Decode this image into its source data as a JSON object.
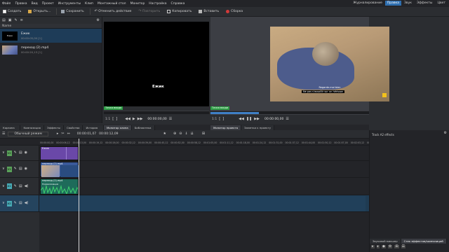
{
  "menu": [
    "Файл",
    "Правка",
    "Вид",
    "Проект",
    "Инструменты",
    "Клип",
    "Монтажный стол",
    "Монитор",
    "Настройка",
    "Справка"
  ],
  "workspaces": {
    "items": [
      "Журналирование",
      "Правка",
      "Звук",
      "Эффекты",
      "Цвет"
    ],
    "active": "Правка"
  },
  "toolbar": {
    "create": "Создать",
    "open": "Открыть...",
    "save": "Сохранить",
    "undo": "Отменить действие",
    "redo": "Повторить",
    "copy": "Копировать",
    "paste": "Вставить",
    "render": "Сборка"
  },
  "bin": {
    "column": "Name",
    "items": [
      {
        "name": "Ежик",
        "sub": "00:00:05,00 [1]"
      },
      {
        "name": "переход (2).mp4",
        "sub": "00:00:20,13 [1]"
      }
    ]
  },
  "clip_monitor": {
    "title_text": "Ежик",
    "zone": "Точка входа",
    "zoom": "1:1",
    "timecode": "00:00:00,00"
  },
  "project_monitor": {
    "subtitle1": "Regarde-moi bien",
    "subtitle2": "Ne pas s'assaillir sur un hérisson",
    "zone": "Точка входа",
    "zoom": "1:1",
    "timecode": "00:00:00,00"
  },
  "dock_tabs": [
    "Корзина про...",
    "Композиция",
    "Эффекты",
    "Свойства к...",
    "История дей..."
  ],
  "clip_tabs": [
    "Монитор клипа",
    "Библиотека"
  ],
  "proj_tabs": [
    "Монитор проекта",
    "Заметки к проекту"
  ],
  "timeline": {
    "mode": "Обычный режим",
    "timecode": "00:00:01,07",
    "duration": "00:00:12,09",
    "ticks": [
      "00:00:00,00",
      "00:00:06,12",
      "00:00:13,00",
      "00:00:19,12",
      "00:00:26,00",
      "00:00:32,12",
      "00:00:39,00",
      "00:00:45,12",
      "00:00:52,00",
      "00:00:58,12",
      "00:01:05,00",
      "00:01:11,12",
      "00:01:18,00",
      "00:01:24,12",
      "00:01:31,00",
      "00:01:37,12",
      "00:01:44,00",
      "00:01:50,12",
      "00:01:57,00",
      "00:02:03,12",
      "00:02:10,00"
    ],
    "tracks": [
      {
        "badge": "V2",
        "color": "#5aa25a"
      },
      {
        "badge": "V1",
        "color": "#5aa25a"
      },
      {
        "badge": "A1",
        "color": "#47a9b4"
      },
      {
        "badge": "A2",
        "color": "#47a9b4"
      }
    ],
    "clips": {
      "title": "Ежик",
      "video": "переход (2).mp4",
      "audio": "переход (2).mp4",
      "audio_sub": "Нормализация"
    }
  },
  "effects_panel": {
    "title": "Track A2 effects",
    "tabs": [
      "Звуковой микшер",
      "Стек эффектов/композиций"
    ]
  }
}
